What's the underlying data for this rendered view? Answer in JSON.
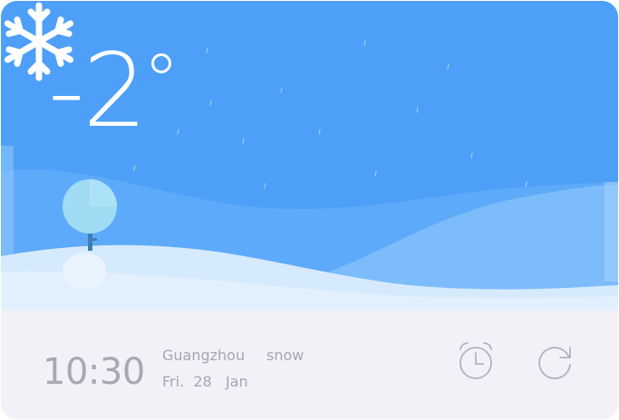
{
  "weather": {
    "temperature": "-2",
    "condition_icon": "snowflake-icon"
  },
  "footer": {
    "time": "10:30",
    "city": "Guangzhou",
    "condition": "snow",
    "date": "Fri.  28   Jan",
    "alarm_icon": "alarm-clock-icon",
    "refresh_icon": "refresh-icon"
  },
  "colors": {
    "sky": "#4d9ff7",
    "hill_back": "#6cb0fa",
    "hill_front": "#d6eafd",
    "footer_bg": "#f1f1f7",
    "footer_text": "#a8a8b2"
  }
}
